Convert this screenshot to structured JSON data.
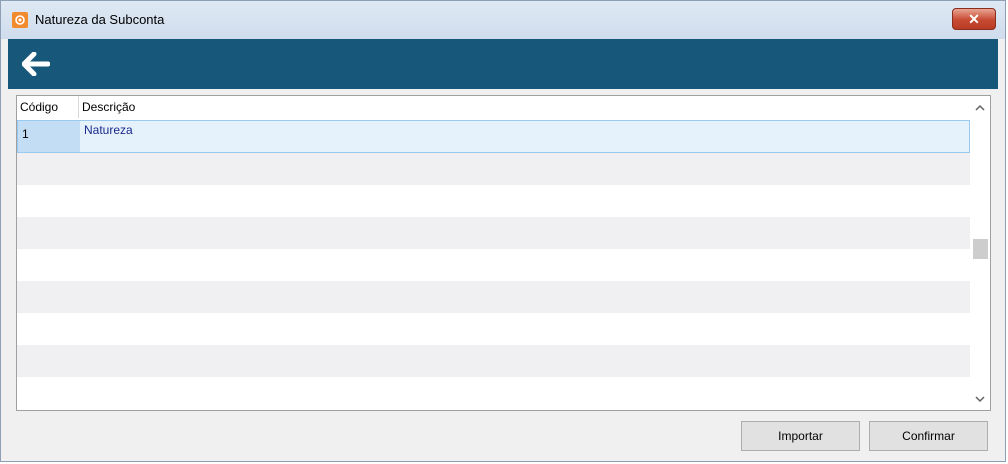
{
  "window": {
    "title": "Natureza da Subconta",
    "close_symbol": "✕"
  },
  "icons": {
    "app": "app-logo-icon",
    "back": "arrow-left-icon",
    "close": "close-icon",
    "scroll_up": "chevron-up-icon",
    "scroll_down": "chevron-down-icon"
  },
  "grid": {
    "columns": [
      "Código",
      "Descrição"
    ],
    "rows": [
      {
        "codigo": "1",
        "descricao": "Natureza"
      }
    ],
    "selected_row": 0
  },
  "buttons": {
    "importar": "Importar",
    "confirmar": "Confirmar"
  },
  "colors": {
    "toolbar": "#17587a",
    "selection": "#e5f1fb",
    "close": "#c74a32"
  }
}
